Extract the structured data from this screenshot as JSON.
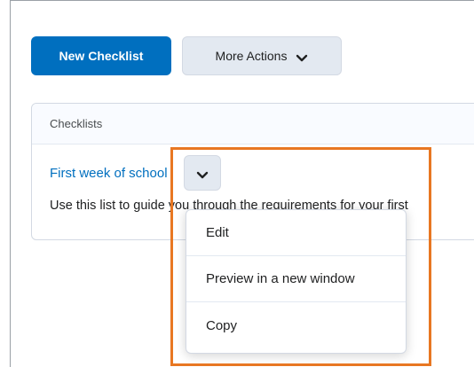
{
  "toolbar": {
    "new_checklist_label": "New Checklist",
    "more_actions_label": "More Actions"
  },
  "panel": {
    "header": "Checklists",
    "item": {
      "title": "First week of school",
      "description": "Use this list to guide you through the requirements for your first"
    }
  },
  "context_menu": {
    "items": [
      "Edit",
      "Preview in a new window",
      "Copy"
    ]
  },
  "colors": {
    "primary": "#006fbf",
    "secondary_bg": "#e3e9f1",
    "highlight": "#e87722"
  },
  "icons": {
    "more_actions": "chevron-down-icon",
    "item_context": "chevron-down-icon"
  }
}
